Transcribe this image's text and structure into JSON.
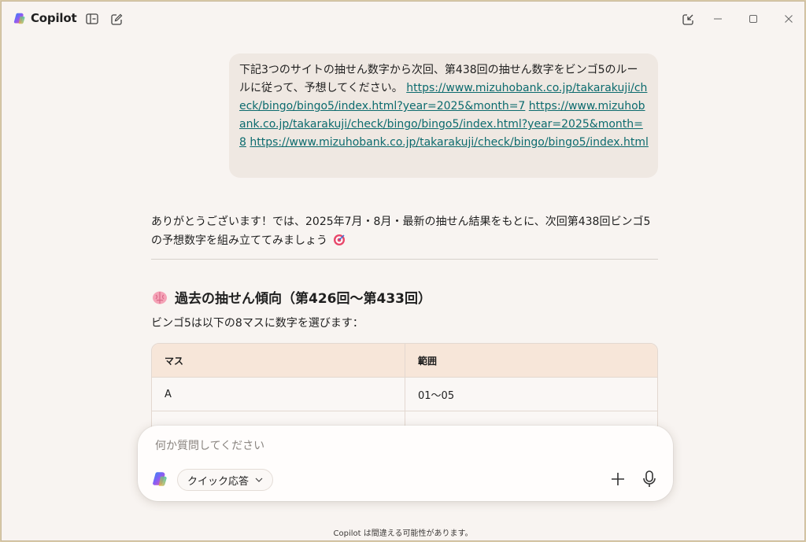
{
  "app": {
    "name": "Copilot"
  },
  "user_message": {
    "text": "下記3つのサイトの抽せん数字から次回、第438回の抽せん数字をビンゴ5のルールに従って、予想してください。",
    "links": [
      "https://www.mizuhobank.co.jp/takarakuji/check/bingo/bingo5/index.html?year=2025&month=7",
      "https://www.mizuhobank.co.jp/takarakuji/check/bingo/bingo5/index.html?year=2025&month=8",
      "https://www.mizuhobank.co.jp/takarakuji/check/bingo/bingo5/index.html"
    ]
  },
  "reply": {
    "text": "ありがとうございます！では、2025年7月・8月・最新の抽せん結果をもとに、次回第438回ビンゴ5の予想数字を組み立ててみましょう",
    "heading": "過去の抽せん傾向（第426回〜第433回）",
    "intro": "ビンゴ5は以下の8マスに数字を選びます：",
    "table": {
      "headers": [
        "マス",
        "範囲"
      ],
      "rows": [
        [
          "A",
          "01〜05"
        ]
      ]
    }
  },
  "composer": {
    "placeholder": "何か質問してください",
    "mode_label": "クイック応答"
  },
  "footer": "Copilot は間違える可能性があります。",
  "colors": {
    "accent_link": "#0c6b6e",
    "background": "#f8f4f1",
    "bubble": "#efe8e2",
    "table_header": "#f7e6d9"
  }
}
